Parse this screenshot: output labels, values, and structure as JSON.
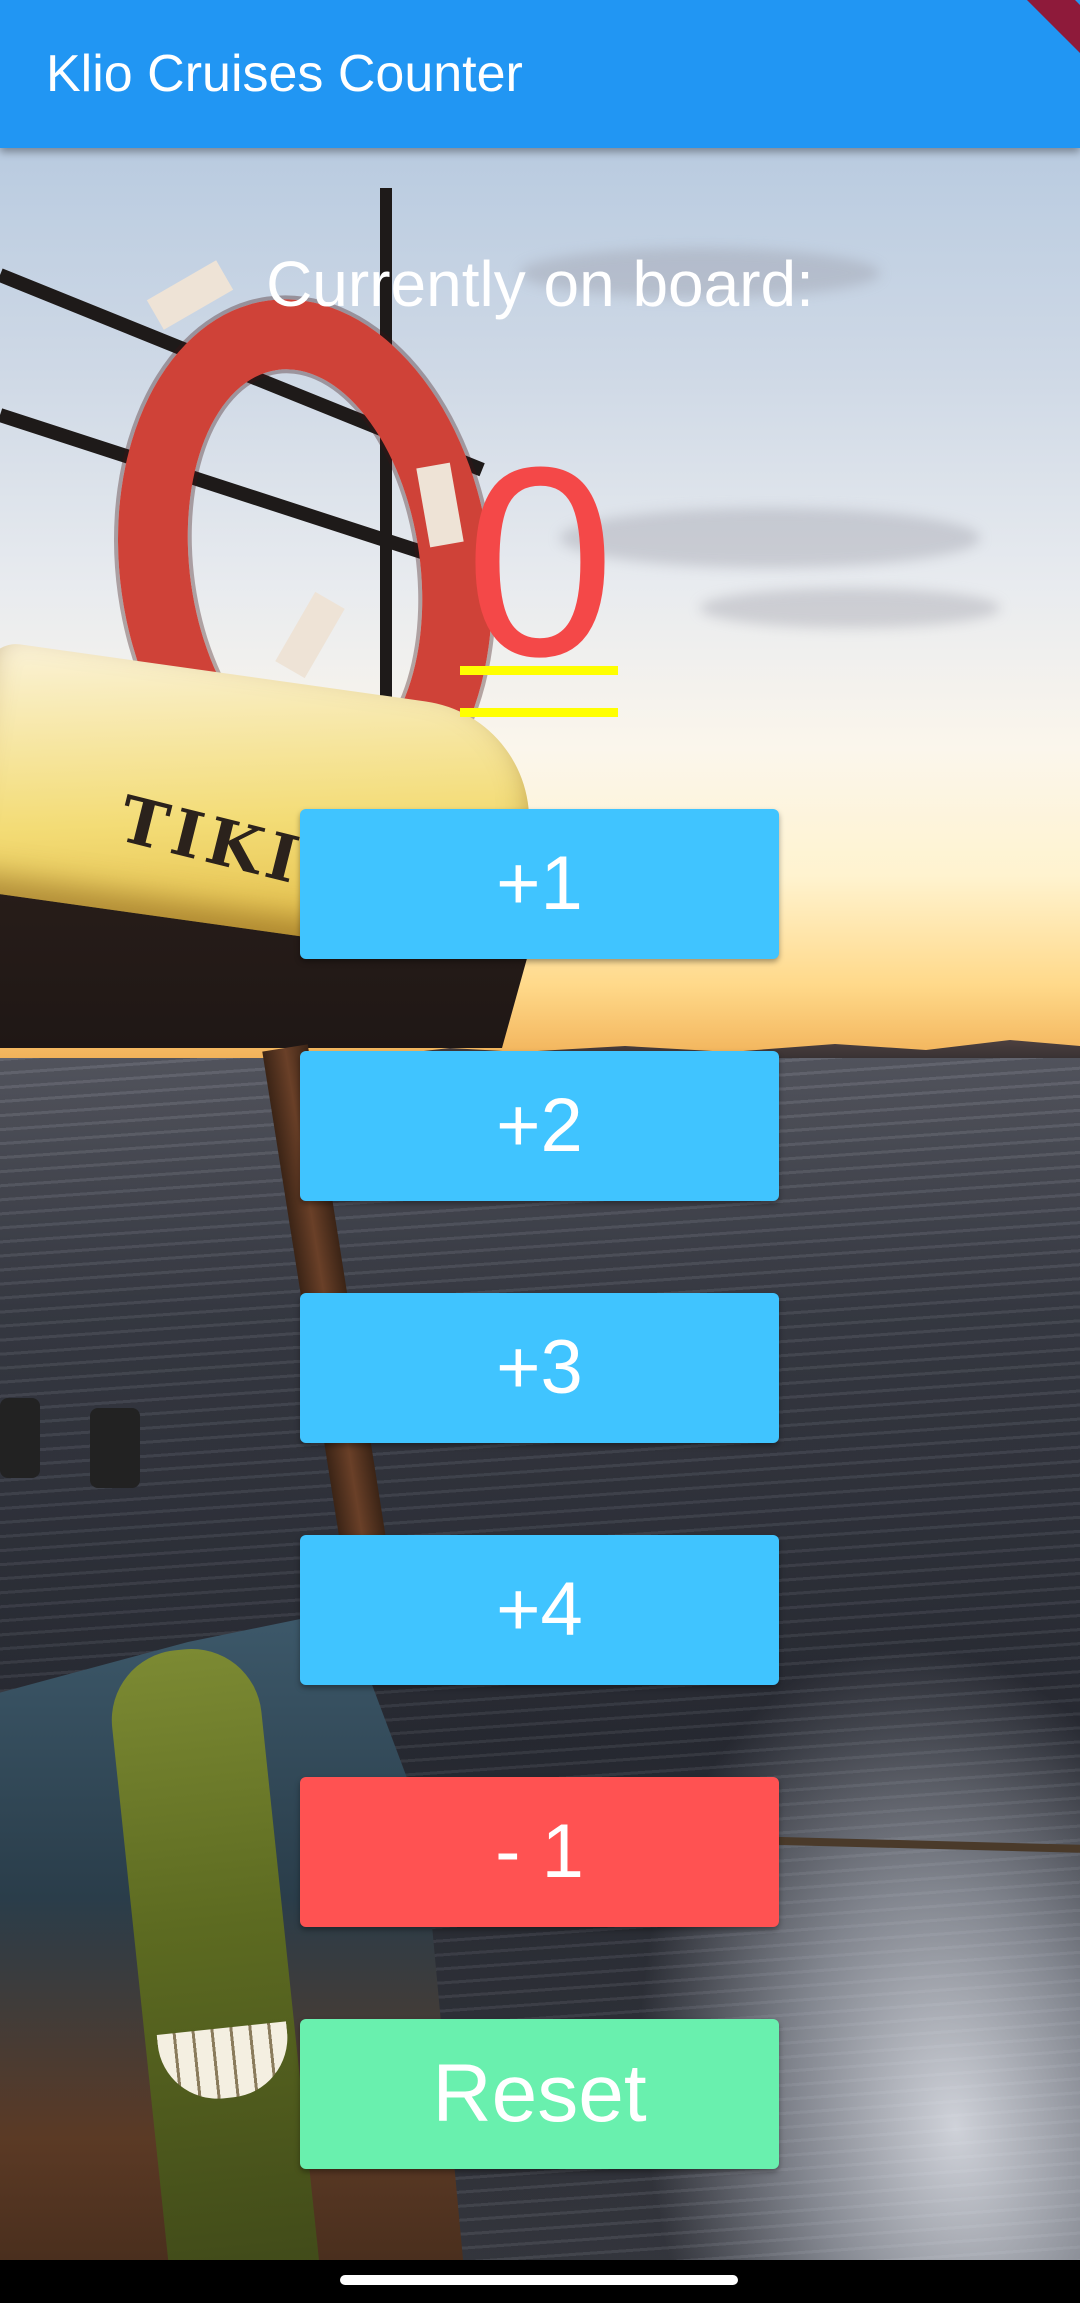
{
  "app_bar": {
    "title": "Klio Cruises Counter",
    "color": "#2196F3"
  },
  "counter": {
    "label": "Currently on board:",
    "value": "0",
    "value_color": "#F44848",
    "underline_color": "#FFFF00"
  },
  "buttons": [
    {
      "label": "+1",
      "color": "#40C4FF"
    },
    {
      "label": "+2",
      "color": "#40C4FF"
    },
    {
      "label": "+3",
      "color": "#40C4FF"
    },
    {
      "label": "+4",
      "color": "#40C4FF"
    },
    {
      "label": "- 1",
      "color": "#FF5252"
    },
    {
      "label": "Reset",
      "color": "#69F0AE"
    }
  ],
  "background": {
    "description_icon": "boat-sunset-photo",
    "painted_text": "TIKI BAR"
  }
}
